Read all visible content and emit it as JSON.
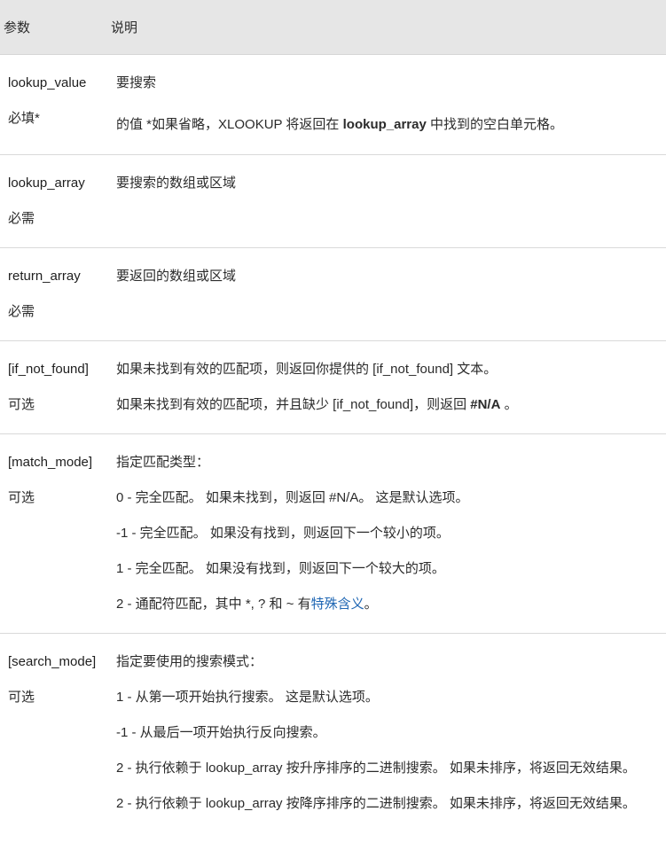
{
  "header": {
    "col_param": "参数",
    "col_desc": "说明"
  },
  "rows": {
    "lookup_value": {
      "name": "lookup_value",
      "req": "必填*",
      "d0": "要搜索",
      "d1_pre": "的值 *如果省略，XLOOKUP 将返回在 ",
      "d1_bold": "lookup_array",
      "d1_post": " 中找到的空白单元格。"
    },
    "lookup_array": {
      "name": "lookup_array",
      "req": "必需",
      "d0": "要搜索的数组或区域"
    },
    "return_array": {
      "name": "return_array",
      "req": "必需",
      "d0": "要返回的数组或区域"
    },
    "if_not_found": {
      "name": "[if_not_found]",
      "req": "可选",
      "d0": "如果未找到有效的匹配项，则返回你提供的 [if_not_found] 文本。",
      "d1_pre": "如果未找到有效的匹配项，并且缺少 [if_not_found]，则返回 ",
      "d1_bold": "#N/A",
      "d1_post": " 。"
    },
    "match_mode": {
      "name": "[match_mode]",
      "req": "可选",
      "d0": "指定匹配类型：",
      "d1": "0 - 完全匹配。 如果未找到，则返回 #N/A。 这是默认选项。",
      "d2": "-1 - 完全匹配。 如果没有找到，则返回下一个较小的项。",
      "d3": "1 - 完全匹配。 如果没有找到，则返回下一个较大的项。",
      "d4_pre": "2 - 通配符匹配，其中 *, ? 和 ~ 有",
      "d4_link": "特殊含义",
      "d4_post": "。"
    },
    "search_mode": {
      "name": "[search_mode]",
      "req": "可选",
      "d0": "指定要使用的搜索模式：",
      "d1": "1 - 从第一项开始执行搜索。 这是默认选项。",
      "d2": "-1 - 从最后一项开始执行反向搜索。",
      "d3": "2 - 执行依赖于 lookup_array 按升序排序的二进制搜索。 如果未排序，将返回无效结果。",
      "d4": "2 - 执行依赖于 lookup_array 按降序排序的二进制搜索。 如果未排序，将返回无效结果。"
    }
  }
}
